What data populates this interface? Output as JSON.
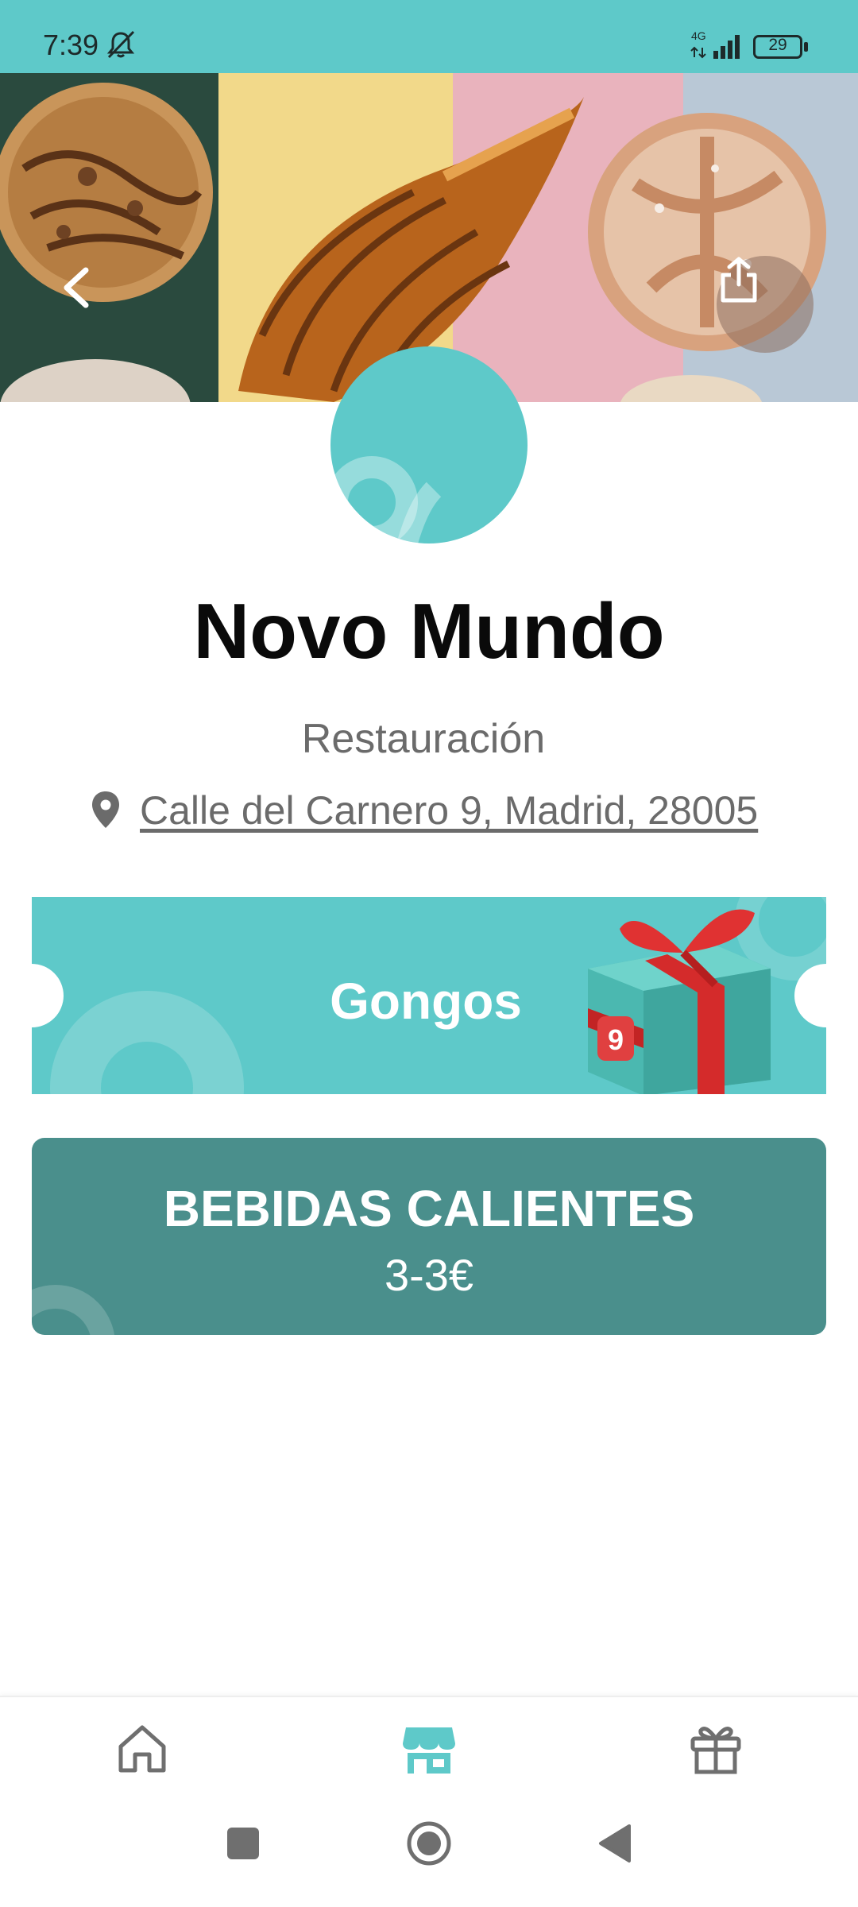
{
  "status_bar": {
    "time": "7:39",
    "network": "4G",
    "battery": "29"
  },
  "icons": {
    "status": [
      "bell-off-icon",
      "signal-icon",
      "battery-icon"
    ],
    "hero": [
      "back-arrow-icon",
      "share-icon"
    ],
    "nav": [
      "home-icon",
      "store-icon",
      "gift-icon"
    ],
    "system": [
      "recents-square-icon",
      "home-circle-icon",
      "back-triangle-icon"
    ]
  },
  "store": {
    "name": "Novo Mundo",
    "category": "Restauración",
    "address": "Calle del Carnero 9, Madrid, 28005"
  },
  "gongos_card": {
    "label": "Gongos",
    "badge": "9"
  },
  "product_card": {
    "title": "BEBIDAS CALIENTES",
    "price": "3-3€"
  },
  "bottom_nav": {
    "active": "store"
  },
  "colors": {
    "brand_teal": "#5ec9c9",
    "card_dark_teal": "#4a8f8c",
    "text_gray": "#6b6b6b",
    "gift_red": "#d42b2b"
  }
}
